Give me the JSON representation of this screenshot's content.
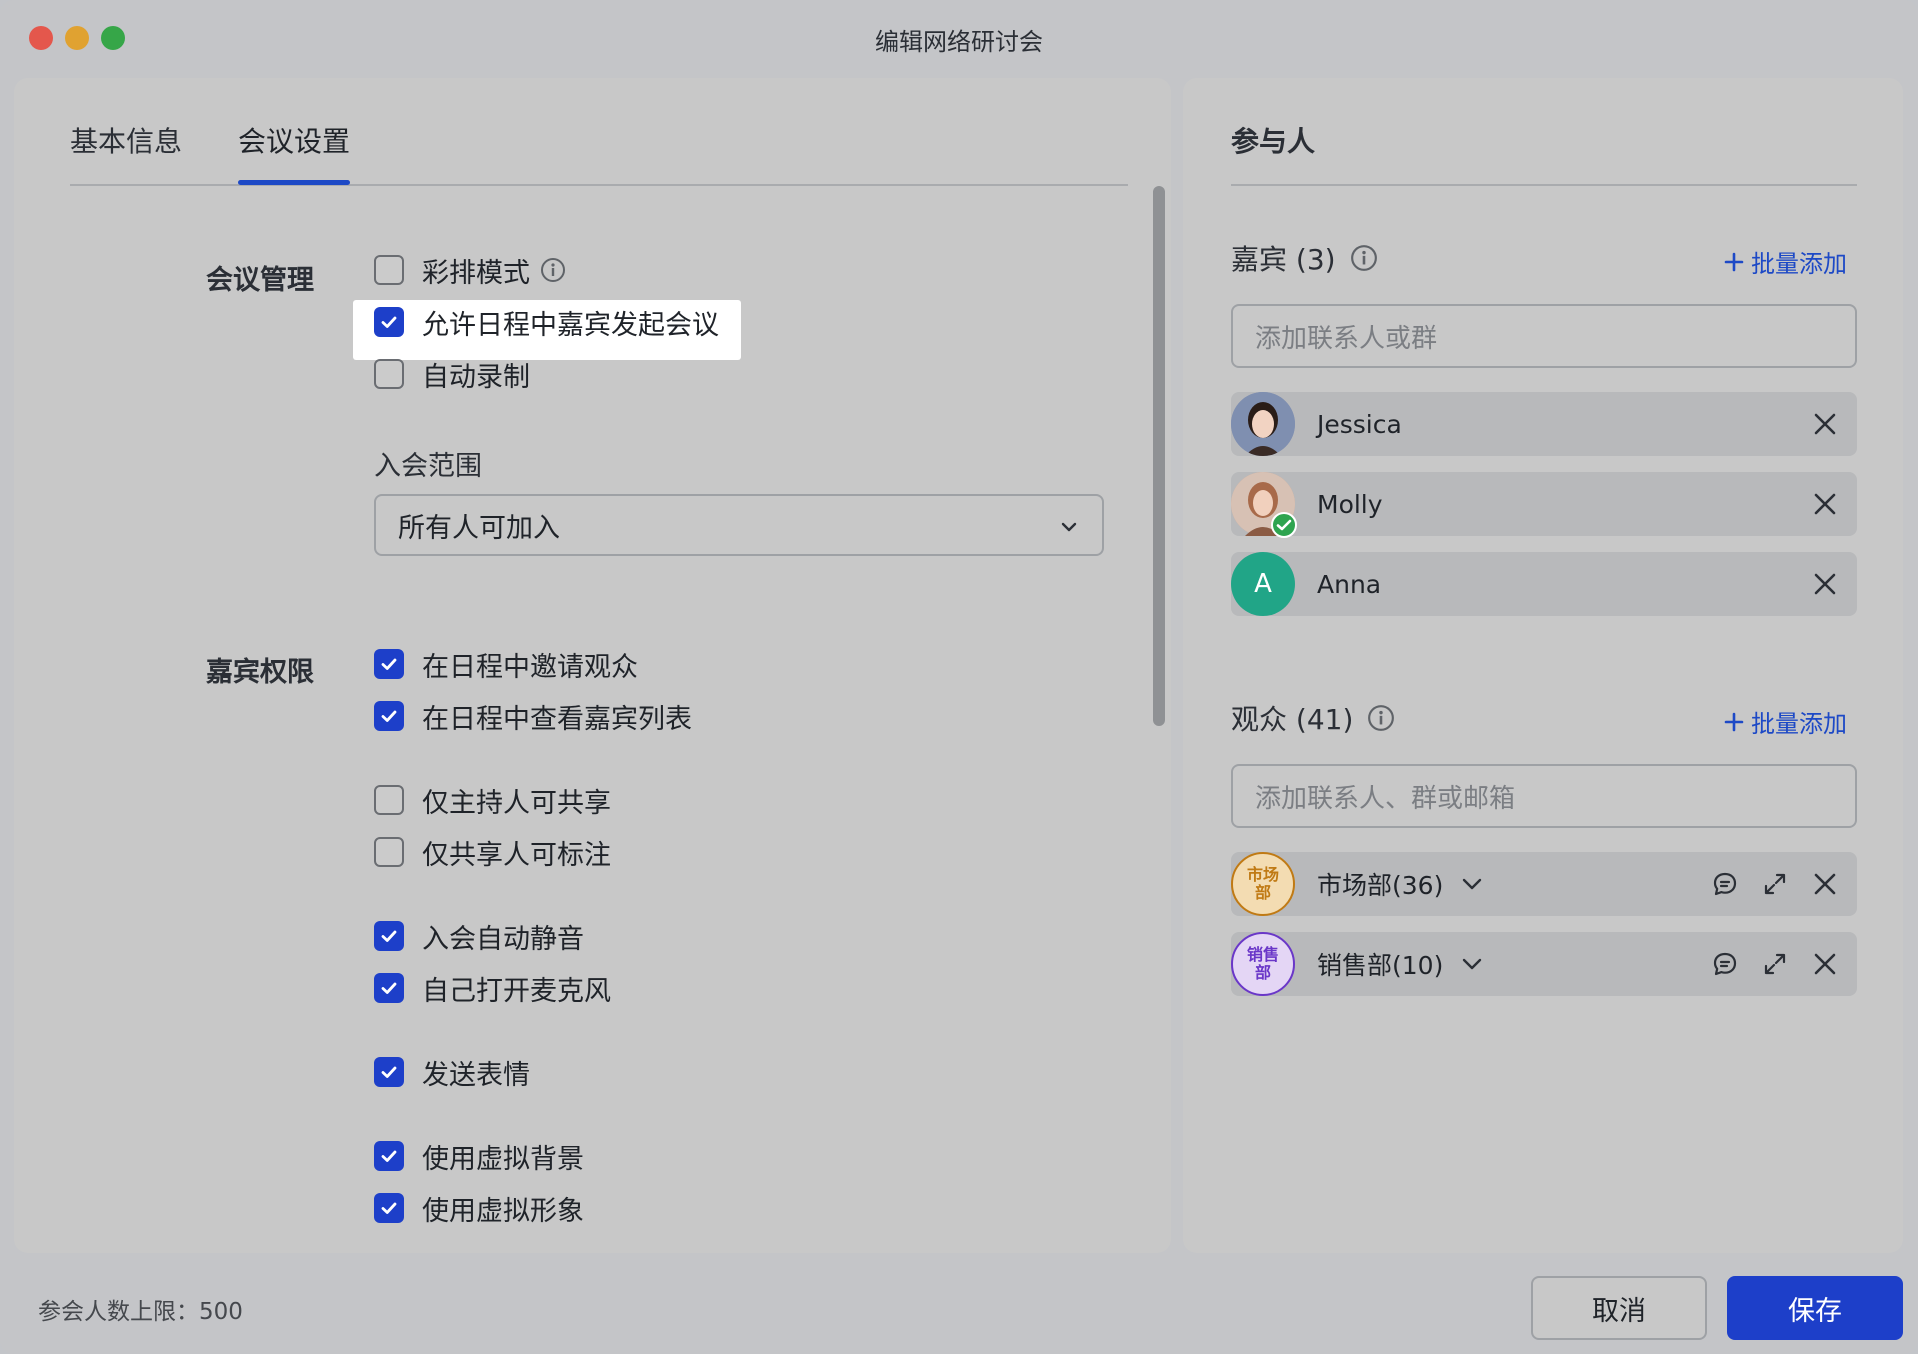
{
  "window": {
    "title": "编辑网络研讨会"
  },
  "tabs": [
    {
      "label": "基本信息",
      "active": false
    },
    {
      "label": "会议设置",
      "active": true
    }
  ],
  "meeting_management": {
    "label": "会议管理",
    "options": [
      {
        "label": "彩排模式",
        "checked": false,
        "has_info": true
      },
      {
        "label": "允许日程中嘉宾发起会议",
        "checked": true,
        "highlighted": true
      },
      {
        "label": "自动录制",
        "checked": false
      }
    ],
    "join_scope": {
      "label": "入会范围",
      "value": "所有人可加入"
    }
  },
  "guest_permissions": {
    "label": "嘉宾权限",
    "options": [
      {
        "label": "在日程中邀请观众",
        "checked": true
      },
      {
        "label": "在日程中查看嘉宾列表",
        "checked": true
      },
      {
        "label": "仅主持人可共享",
        "checked": false
      },
      {
        "label": "仅共享人可标注",
        "checked": false
      },
      {
        "label": "入会自动静音",
        "checked": true
      },
      {
        "label": "自己打开麦克风",
        "checked": true
      },
      {
        "label": "发送表情",
        "checked": true
      },
      {
        "label": "使用虚拟背景",
        "checked": true
      },
      {
        "label": "使用虚拟形象",
        "checked": true
      }
    ]
  },
  "participants": {
    "title": "参与人",
    "guests": {
      "title": "嘉宾 (3)",
      "bulk_add": "批量添加",
      "placeholder": "添加联系人或群",
      "people": [
        {
          "name": "Jessica"
        },
        {
          "name": "Molly",
          "verified": true
        },
        {
          "name": "Anna",
          "initial": "A"
        }
      ]
    },
    "audience": {
      "title": "观众 (41)",
      "bulk_add": "批量添加",
      "placeholder": "添加联系人、群或邮箱",
      "groups": [
        {
          "avatar_text": "市场部",
          "name": "市场部(36)",
          "color": "#c07a14"
        },
        {
          "avatar_text": "销售部",
          "name": "销售部(10)",
          "color": "#6a37c8"
        }
      ]
    }
  },
  "footer": {
    "limit_text": "参会人数上限：500",
    "cancel_label": "取消",
    "save_label": "保存"
  },
  "colors": {
    "accent": "#1d3fc9",
    "anna_avatar": "#21a587",
    "verified": "#2ea44f"
  }
}
